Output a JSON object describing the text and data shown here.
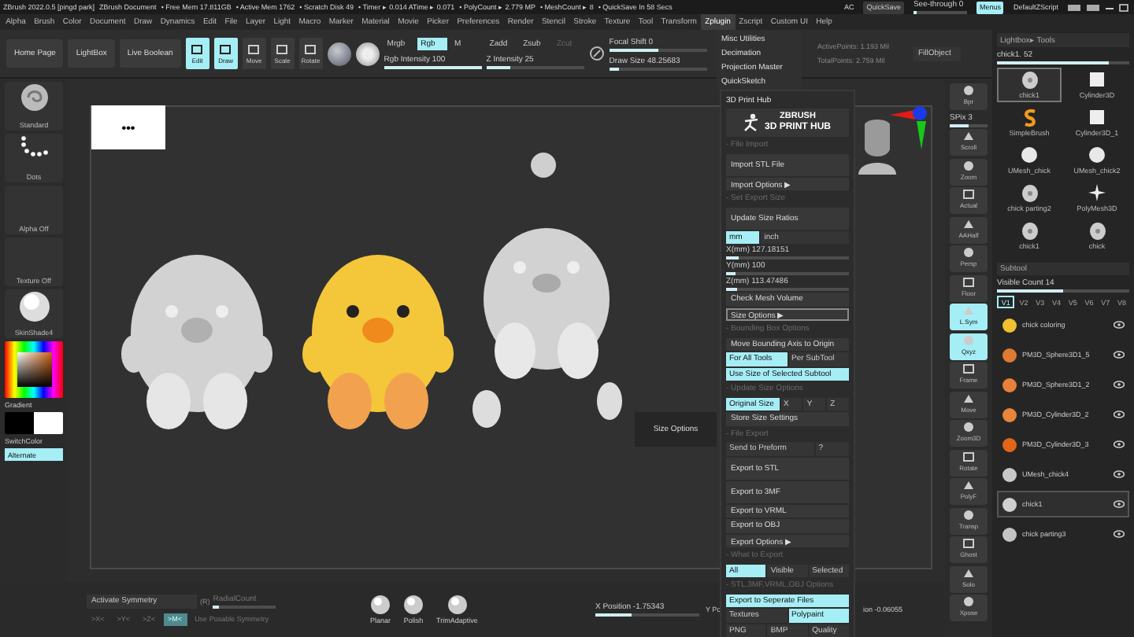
{
  "title_bar": {
    "items": [
      "ZBrush 2022.0.5 [pingd park]",
      "ZBrush Document",
      "• Free Mem 17.811GB",
      "• Active Mem 1762",
      "• Scratch Disk 49",
      "• Timer ▸ 0.014 ATime ▸ 0.071",
      "• PolyCount ▸ 2.779 MP",
      "• MeshCount ▸ 8",
      "• QuickSave In 58 Secs"
    ],
    "ac": "AC",
    "quicksave": "QuickSave",
    "see_through": {
      "label": "See-through  0",
      "level": 0
    },
    "menus": {
      "label": "Menus",
      "selected": true
    },
    "script": "DefaultZScript"
  },
  "menu_bar": [
    {
      "label": "Alpha",
      "selected": false
    },
    {
      "label": "Brush",
      "selected": false
    },
    {
      "label": "Color",
      "selected": false
    },
    {
      "label": "Document",
      "selected": false
    },
    {
      "label": "Draw",
      "selected": false
    },
    {
      "label": "Dynamics",
      "selected": false
    },
    {
      "label": "Edit",
      "selected": false
    },
    {
      "label": "File",
      "selected": false
    },
    {
      "label": "Layer",
      "selected": false
    },
    {
      "label": "Light",
      "selected": false
    },
    {
      "label": "Macro",
      "selected": false
    },
    {
      "label": "Marker",
      "selected": false
    },
    {
      "label": "Material",
      "selected": false
    },
    {
      "label": "Movie",
      "selected": false
    },
    {
      "label": "Picker",
      "selected": false
    },
    {
      "label": "Preferences",
      "selected": false
    },
    {
      "label": "Render",
      "selected": false
    },
    {
      "label": "Stencil",
      "selected": false
    },
    {
      "label": "Stroke",
      "selected": false
    },
    {
      "label": "Texture",
      "selected": false
    },
    {
      "label": "Tool",
      "selected": false
    },
    {
      "label": "Transform",
      "selected": false
    },
    {
      "label": "Zplugin",
      "selected": true
    },
    {
      "label": "Zscript",
      "selected": false
    },
    {
      "label": "Custom UI",
      "selected": false
    },
    {
      "label": "Help",
      "selected": false
    }
  ],
  "top_shelf": {
    "buttons": [
      "Home Page",
      "LightBox",
      "Live Boolean"
    ],
    "tools": [
      {
        "label": "Edit",
        "selected": true
      },
      {
        "label": "Draw",
        "selected": true
      },
      {
        "label": "Move",
        "selected": false
      },
      {
        "label": "Scale",
        "selected": false
      },
      {
        "label": "Rotate",
        "selected": false
      }
    ],
    "color_modes": [
      {
        "label": "Mrgb",
        "selected": false
      },
      {
        "label": "Rgb",
        "selected": true
      },
      {
        "label": "M",
        "selected": false
      }
    ],
    "rgb_intensity": {
      "label": "Rgb Intensity 100",
      "level": 1
    },
    "z_modes": [
      {
        "label": "Zadd",
        "selected": false,
        "disabled": false
      },
      {
        "label": "Zsub",
        "selected": false,
        "disabled": false
      },
      {
        "label": "Zcut",
        "selected": false,
        "disabled": true
      }
    ],
    "z_intensity": {
      "label": "Z Intensity 25",
      "level": 0.25
    },
    "focal_shift": {
      "label": "Focal Shift 0",
      "level": 0.5
    },
    "draw_size": {
      "label": "Draw Size 48.25683",
      "level": 0.1
    },
    "active_points": "ActivePoints: 1.193 Mil",
    "total_points": "TotalPoints: 2.759 Mil",
    "fill_object": "FillObject"
  },
  "left_shelf": {
    "brush": "Standard",
    "stroke": "Dots",
    "alpha": "Alpha Off",
    "texture": "Texture Off",
    "material": "SkinShade4",
    "gradient": "Gradient",
    "switch_color": "SwitchColor",
    "alternate": {
      "label": "Alternate",
      "selected": true
    }
  },
  "canvas": {
    "note": "•••",
    "tooltip": "Size Options"
  },
  "zplugin_menu": {
    "items": [
      "Misc Utilities",
      "Decimation",
      "Projection Master",
      "QuickSketch"
    ],
    "hub_rows": [
      {
        "kind": "title",
        "label": "3D Print Hub"
      },
      {
        "kind": "logo",
        "brand": "ZBRUSH",
        "label": "3D PRINT HUB"
      },
      {
        "kind": "header",
        "label": "- File Import"
      },
      {
        "kind": "button",
        "label": "Import STL File",
        "tall": true,
        "hover": false
      },
      {
        "kind": "button",
        "label": "Import Options ▶",
        "tall": false,
        "hover": false
      },
      {
        "kind": "header",
        "label": "- Set Export Size"
      },
      {
        "kind": "button",
        "label": "Update Size Ratios",
        "tall": true,
        "hover": false
      },
      {
        "kind": "toggles",
        "items": [
          {
            "label": "mm",
            "selected": true
          },
          {
            "label": "inch",
            "selected": false
          }
        ]
      },
      {
        "kind": "slider",
        "label": "X(mm) 127.18151",
        "level": 0.1
      },
      {
        "kind": "slider",
        "label": "Y(mm) 100",
        "level": 0.08
      },
      {
        "kind": "slider",
        "label": "Z(mm) 113.47486",
        "level": 0.09
      },
      {
        "kind": "button",
        "label": "Check Mesh Volume",
        "tall": false,
        "hover": false
      },
      {
        "kind": "button",
        "label": "Size Options ▶",
        "tall": false,
        "hover": true
      },
      {
        "kind": "header",
        "label": "- Bounding Box Options"
      },
      {
        "kind": "button",
        "label": "Move Bounding Axis to Origin",
        "tall": false,
        "hover": false
      },
      {
        "kind": "toggles",
        "items": [
          {
            "label": "For All Tools",
            "selected": true
          },
          {
            "label": "Per SubTool",
            "selected": false
          }
        ]
      },
      {
        "kind": "toggles",
        "items": [
          {
            "label": "Use Size of Selected Subtool",
            "selected": true
          }
        ]
      },
      {
        "kind": "header",
        "label": "- Update Size Options"
      },
      {
        "kind": "toggles",
        "items": [
          {
            "label": "Original Size",
            "selected": true
          },
          {
            "label": "X",
            "selected": false
          },
          {
            "label": "Y",
            "selected": false
          },
          {
            "label": "Z",
            "selected": false
          }
        ]
      },
      {
        "kind": "button",
        "label": "Store Size Settings",
        "tall": false,
        "hover": false
      },
      {
        "kind": "header",
        "label": "- File Export"
      },
      {
        "kind": "toggles",
        "items": [
          {
            "label": "Send to Preform",
            "selected": false
          },
          {
            "label": "?",
            "selected": false
          }
        ]
      },
      {
        "kind": "button",
        "label": "Export to STL",
        "tall": true,
        "hover": false
      },
      {
        "kind": "button",
        "label": "Export to 3MF",
        "tall": true,
        "hover": false
      },
      {
        "kind": "button",
        "label": "Export to VRML",
        "tall": false,
        "hover": false
      },
      {
        "kind": "button",
        "label": "Export to OBJ",
        "tall": false,
        "hover": false
      },
      {
        "kind": "button",
        "label": "Export Options ▶",
        "tall": false,
        "hover": false
      },
      {
        "kind": "header",
        "label": "- What to Export"
      },
      {
        "kind": "toggles",
        "items": [
          {
            "label": "All",
            "selected": true
          },
          {
            "label": "Visible",
            "selected": false
          },
          {
            "label": "Selected",
            "selected": false
          }
        ]
      },
      {
        "kind": "header",
        "label": "- STL,3MF,VRML,OBJ Options"
      },
      {
        "kind": "toggles",
        "items": [
          {
            "label": "Export to Seperate Files",
            "selected": true
          }
        ]
      },
      {
        "kind": "toggles",
        "items": [
          {
            "label": "Textures",
            "selected": false
          },
          {
            "label": "Polypaint",
            "selected": true
          }
        ]
      },
      {
        "kind": "toggles",
        "items": [
          {
            "label": "PNG",
            "selected": false
          },
          {
            "label": "BMP",
            "selected": false
          },
          {
            "label": "Quality",
            "selected": false
          }
        ]
      }
    ]
  },
  "right_toolbar": [
    {
      "kind": "button",
      "label": "Bpr",
      "selected": false
    },
    {
      "kind": "slider",
      "label": "SPix 3",
      "level": 0.5
    },
    {
      "kind": "button",
      "label": "Scroll",
      "selected": false
    },
    {
      "kind": "button",
      "label": "Zoom",
      "selected": false
    },
    {
      "kind": "button",
      "label": "Actual",
      "selected": false
    },
    {
      "kind": "button",
      "label": "AAHalf",
      "selected": false
    },
    {
      "kind": "button",
      "label": "Persp",
      "selected": false
    },
    {
      "kind": "button",
      "label": "Floor",
      "selected": false
    },
    {
      "kind": "button",
      "label": "L.Sym",
      "selected": true
    },
    {
      "kind": "button",
      "label": "Qxyz",
      "selected": true
    },
    {
      "kind": "button",
      "label": "Frame",
      "selected": false
    },
    {
      "kind": "button",
      "label": "Move",
      "selected": false
    },
    {
      "kind": "button",
      "label": "Zoom3D",
      "selected": false
    },
    {
      "kind": "button",
      "label": "Rotate",
      "selected": false
    },
    {
      "kind": "button",
      "label": "PolyF",
      "selected": false
    },
    {
      "kind": "button",
      "label": "Transp",
      "selected": false
    },
    {
      "kind": "button",
      "label": "Ghost",
      "selected": false
    },
    {
      "kind": "button",
      "label": "Solo",
      "selected": false
    },
    {
      "kind": "button",
      "label": "Xpose",
      "selected": false
    }
  ],
  "tool_panel": {
    "title": "Lightbox▸ Tools",
    "tool_slider": {
      "label": "chick1. 52",
      "level": 0.85
    },
    "tools": [
      {
        "label": "chick1",
        "kind": "chick",
        "selected": true
      },
      {
        "label": "Cylinder3D",
        "kind": "cylinder",
        "selected": false
      },
      {
        "label": "SimpleBrush",
        "kind": "brush",
        "selected": false
      },
      {
        "label": "Cylinder3D_1",
        "kind": "cylinder",
        "selected": false
      },
      {
        "label": "UMesh_chick",
        "kind": "sphere",
        "selected": false
      },
      {
        "label": "UMesh_chick2",
        "kind": "sphere",
        "selected": false
      },
      {
        "label": "chick parting2",
        "kind": "chick",
        "selected": false
      },
      {
        "label": "PolyMesh3D",
        "kind": "star",
        "selected": false
      },
      {
        "label": "chick1",
        "kind": "chick",
        "selected": false
      },
      {
        "label": "chick",
        "kind": "chick",
        "selected": false
      }
    ]
  },
  "subtool": {
    "title": "Subtool",
    "visible_count": {
      "label": "Visible Count 14",
      "level": 0.5
    },
    "tabs": [
      {
        "label": "V1",
        "selected": true
      },
      {
        "label": "V2",
        "selected": false
      },
      {
        "label": "V3",
        "selected": false
      },
      {
        "label": "V4",
        "selected": false
      },
      {
        "label": "V5",
        "selected": false
      },
      {
        "label": "V6",
        "selected": false
      },
      {
        "label": "V7",
        "selected": false
      },
      {
        "label": "V8",
        "selected": false
      }
    ],
    "items": [
      {
        "name": "chick coloring",
        "color": "#f0c030",
        "selected": false
      },
      {
        "name": "PM3D_Sphere3D1_5",
        "color": "#e07a30",
        "selected": false
      },
      {
        "name": "PM3D_Sphere3D1_2",
        "color": "#e8803a",
        "selected": false
      },
      {
        "name": "PM3D_Cylinder3D_2",
        "color": "#e8843c",
        "selected": false
      },
      {
        "name": "PM3D_Cylinder3D_3",
        "color": "#e0651a",
        "selected": false
      },
      {
        "name": "UMesh_chick4",
        "color": "#c8c8c8",
        "selected": false
      },
      {
        "name": "chick1",
        "color": "#d0d0d0",
        "selected": true
      },
      {
        "name": "chick parting3",
        "color": "#c4c4c4",
        "selected": false
      }
    ]
  },
  "bottom_shelf": {
    "activate_symmetry": "Activate Symmetry",
    "r": "(R)",
    "radial_count": {
      "label": "RadialCount",
      "level": 0.1
    },
    "axes": [
      {
        "label": ">X<",
        "selected": false
      },
      {
        "label": ">Y<",
        "selected": false
      },
      {
        "label": ">Z<",
        "selected": false
      },
      {
        "label": ">M<",
        "selected": true
      }
    ],
    "posable": "Use Posable Symmetry",
    "brushes": [
      "Planar",
      "Polish",
      "TrimAdaptive"
    ],
    "x_position": {
      "label": "X Position -1.75343",
      "level": 0.35
    },
    "y_position": "Y Po",
    "z_position": "ion -0.06055"
  }
}
